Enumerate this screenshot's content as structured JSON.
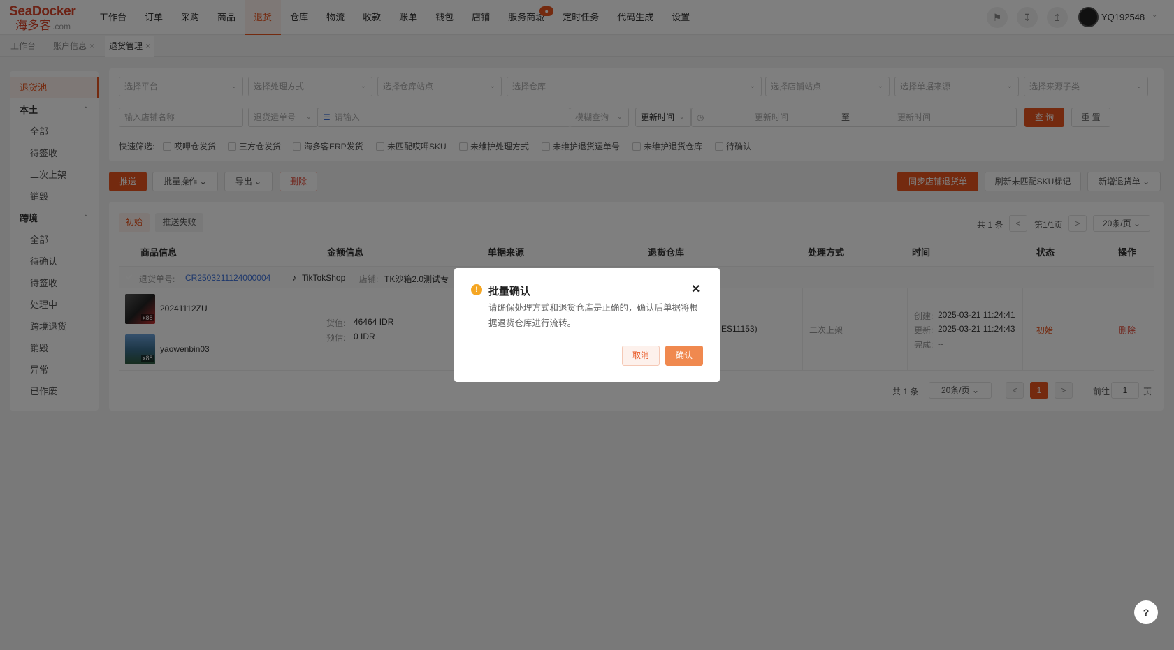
{
  "brand": {
    "line1": "SeaDocker",
    "line2": "海多客",
    "suffix": ".com"
  },
  "nav": {
    "items": [
      "工作台",
      "订单",
      "采购",
      "商品",
      "退货",
      "仓库",
      "物流",
      "收款",
      "账单",
      "钱包",
      "店铺",
      "服务商城",
      "定时任务",
      "代码生成",
      "设置"
    ],
    "active": "退货",
    "badge": "●"
  },
  "header": {
    "username": "YQ192548"
  },
  "tabs": [
    {
      "label": "工作台"
    },
    {
      "label": "账户信息",
      "close": "×"
    },
    {
      "label": "退货管理",
      "close": "×"
    }
  ],
  "sidebar": {
    "top": "退货池",
    "groups": [
      {
        "label": "本土",
        "items": [
          "全部",
          "待签收",
          "二次上架",
          "销毁"
        ]
      },
      {
        "label": "跨境",
        "items": [
          "全部",
          "待确认",
          "待签收",
          "处理中",
          "跨境退货",
          "销毁",
          "异常",
          "已作废"
        ]
      }
    ]
  },
  "filters": {
    "row1": [
      "选择平台",
      "选择处理方式",
      "选择仓库站点",
      "选择仓库",
      "选择店铺站点",
      "选择单据来源",
      "选择来源子类"
    ],
    "shop_name": "输入店铺名称",
    "return_no": "退货运单号",
    "input": "请输入",
    "fuzzy": "模糊查询",
    "time_type": "更新时间",
    "start": "更新时间",
    "to": "至",
    "end": "更新时间",
    "query": "查 询",
    "reset": "重 置",
    "quick_label": "快速筛选:",
    "quick": [
      "哎呷仓发货",
      "三方仓发货",
      "海多客ERP发货",
      "未匹配哎呷SKU",
      "未维护处理方式",
      "未维护退货运单号",
      "未维护退货仓库",
      "待确认"
    ]
  },
  "toolbar": {
    "push": "推送",
    "batch": "批量操作",
    "export": "导出",
    "delete": "删除",
    "sync": "同步店铺退货单",
    "refresh": "刷新未匹配SKU标记",
    "create": "新增退货单"
  },
  "table": {
    "subtabs": [
      "初始",
      "推送失败"
    ],
    "top_pager": {
      "total": "共 1 条",
      "page": "第1/1页",
      "size": "20条/页"
    },
    "headers": [
      "商品信息",
      "金额信息",
      "单据来源",
      "退货仓库",
      "处理方式",
      "时间",
      "状态",
      "操作"
    ],
    "order": {
      "no_label": "退货单号:",
      "no": "CR2503211124000004",
      "platform": "TikTokShop",
      "shop_label": "店铺:",
      "shop": "TK沙箱2.0测试专"
    },
    "products": [
      {
        "sku": "20241112ZU",
        "qty": "x88"
      },
      {
        "sku": "yaowenbin03",
        "qty": "x88"
      }
    ],
    "amount": {
      "goods_label": "货值:",
      "goods": "46464 IDR",
      "est_label": "预估:",
      "est": "0 IDR"
    },
    "warehouse_tail": "ES11153)",
    "method": "二次上架",
    "times": [
      {
        "label": "创建:",
        "value": "2025-03-21 11:24:41"
      },
      {
        "label": "更新:",
        "value": "2025-03-21 11:24:43"
      },
      {
        "label": "完成:",
        "value": "--"
      }
    ],
    "status": "初始",
    "action": "删除",
    "bottom_pager": {
      "total": "共 1 条",
      "size": "20条/页",
      "page": "1",
      "goto": "前往",
      "goto_val": "1",
      "unit": "页"
    }
  },
  "dialog": {
    "title": "批量确认",
    "message": "请确保处理方式和退货仓库是正确的，确认后单据将根据退货仓库进行流转。",
    "cancel": "取消",
    "confirm": "确认",
    "close": "✕"
  },
  "help": "?",
  "colors": {
    "accent": "#e8541e",
    "warn": "#f5a623",
    "link": "#3a6fd8",
    "danger": "#e34d3b"
  }
}
